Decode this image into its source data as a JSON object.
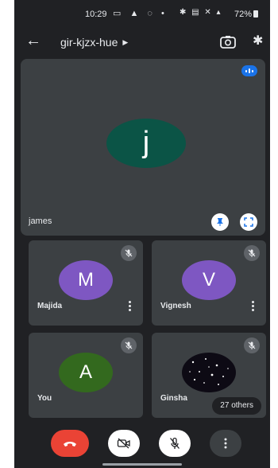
{
  "status_bar": {
    "time": "10:29",
    "battery": "72%"
  },
  "app_bar": {
    "meeting_code": "gir-kjzx-hue",
    "icons": [
      "back-arrow-icon",
      "camera-switch-icon",
      "bluetooth-icon"
    ]
  },
  "main_tile": {
    "initial": "j",
    "name": "james",
    "avatar_color": "#0b5446"
  },
  "participants": [
    {
      "initial": "M",
      "name": "Majida",
      "avatar_color": "#7e57c2"
    },
    {
      "initial": "V",
      "name": "Vignesh",
      "avatar_color": "#7e57c2"
    },
    {
      "initial": "A",
      "name": "You",
      "avatar_color": "#33691e"
    },
    {
      "name": "Ginsha",
      "others": "27 others"
    }
  ],
  "controls": [
    "end-call-button",
    "camera-off-button",
    "mic-off-button",
    "more-options-button"
  ],
  "colors": {
    "background": "#202124",
    "tile": "#3c4043",
    "end_call": "#ea4335",
    "accent": "#1a73e8"
  }
}
